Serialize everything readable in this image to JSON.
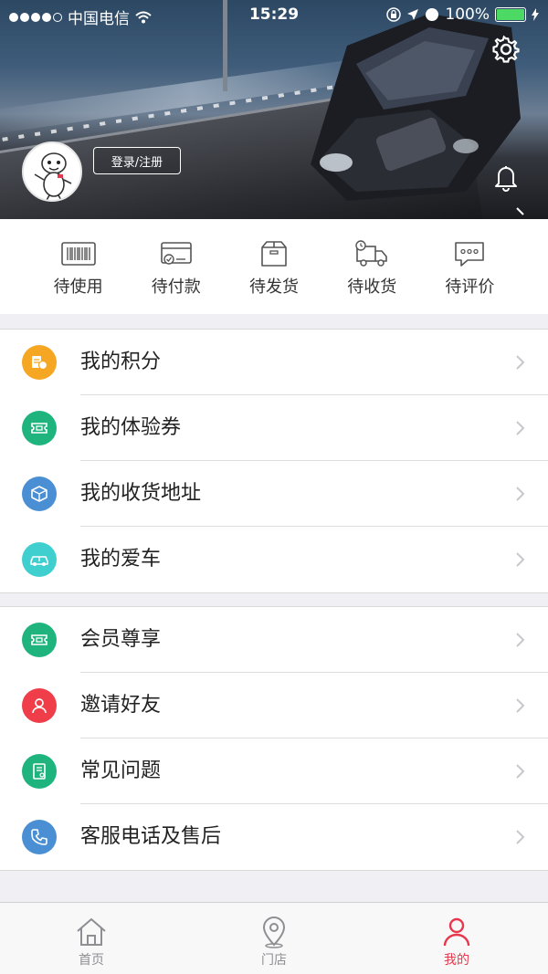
{
  "status_bar": {
    "carrier": "中国电信",
    "time": "15:29",
    "battery": "100%"
  },
  "header": {
    "login_label": "登录/注册"
  },
  "orders": [
    {
      "label": "待使用",
      "icon": "barcode-icon"
    },
    {
      "label": "待付款",
      "icon": "card-icon"
    },
    {
      "label": "待发货",
      "icon": "package-icon"
    },
    {
      "label": "待收货",
      "icon": "truck-icon"
    },
    {
      "label": "待评价",
      "icon": "comment-icon"
    }
  ],
  "menu_group_1": [
    {
      "label": "我的积分",
      "icon": "points-icon",
      "color": "#f5a623"
    },
    {
      "label": "我的体验券",
      "icon": "ticket-icon",
      "color": "#1fb47e"
    },
    {
      "label": "我的收货地址",
      "icon": "box-icon",
      "color": "#4a8fd3"
    },
    {
      "label": "我的爱车",
      "icon": "car-icon",
      "color": "#3fcfcf"
    }
  ],
  "menu_group_2": [
    {
      "label": "会员尊享",
      "icon": "ticket-icon",
      "color": "#1fb47e"
    },
    {
      "label": "邀请好友",
      "icon": "user-icon",
      "color": "#ef3d4a"
    },
    {
      "label": "常见问题",
      "icon": "document-icon",
      "color": "#1fb47e"
    },
    {
      "label": "客服电话及售后",
      "icon": "phone-icon",
      "color": "#4a8fd3"
    }
  ],
  "tabbar": [
    {
      "label": "首页",
      "icon": "home-icon",
      "active": false
    },
    {
      "label": "门店",
      "icon": "location-icon",
      "active": false
    },
    {
      "label": "我的",
      "icon": "profile-icon",
      "active": true
    }
  ],
  "colors": {
    "accent": "#e8374c",
    "battery": "#4cd964"
  }
}
